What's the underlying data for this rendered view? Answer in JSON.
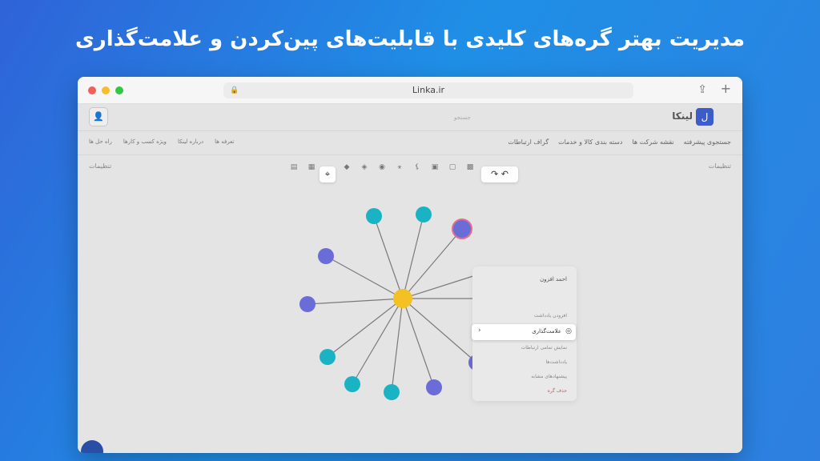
{
  "headline": "مدیریت بهتر گره‌های کلیدی با قابلیت‌های پین‌کردن و علامت‌گذاری",
  "browser": {
    "url": "Linka.ir"
  },
  "app": {
    "logo_text": "لینکا",
    "search_placeholder": "جستجو",
    "menu": [
      "جستجوی پیشرفته",
      "نقشه شرکت ها",
      "دسته بندی کالا و خدمات",
      "گراف ارتباطات"
    ],
    "menu_left": [
      "تعرفه ها",
      "درباره لینکا",
      "ویژه کسب و کارها",
      "راه حل ها"
    ],
    "toolbar_left": "تنظیمات",
    "toolbar_right": "تنظیمات"
  },
  "context_menu": {
    "title": "احمد افزون",
    "items": [
      "افزودن یادداشت",
      "علامت‌گذاری",
      "نمایش تمامی ارتباطات",
      "یادداشت‌ها",
      "پیشنهادهای مشابه",
      "حذف گره"
    ],
    "active_item": "علامت‌گذاری"
  },
  "colors": {
    "accent": "#2f63d8",
    "node_teal": "#19b3c4",
    "node_purple": "#6a6cd8",
    "center_node": "#f5c023"
  }
}
